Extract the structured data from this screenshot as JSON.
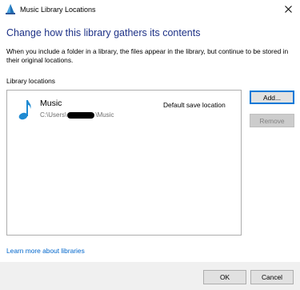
{
  "window": {
    "title": "Music Library Locations",
    "icon": "music-library-icon",
    "close_glyph": "×"
  },
  "heading": "Change how this library gathers its contents",
  "description": "When you include a folder in a library, the files appear in the library, but continue to be stored in their original locations.",
  "locations": {
    "label": "Library locations",
    "items": [
      {
        "name": "Music",
        "path_prefix": "C:\\Users\\",
        "path_suffix": "\\Music",
        "default_label": "Default save location",
        "icon": "music-note-icon"
      }
    ]
  },
  "buttons": {
    "add": "Add...",
    "remove": "Remove",
    "ok": "OK",
    "cancel": "Cancel"
  },
  "learn_more": "Learn more about libraries",
  "colors": {
    "heading": "#1e3287",
    "link": "#0066cc",
    "accent": "#0078d7",
    "note_icon": "#1f8ad2"
  }
}
